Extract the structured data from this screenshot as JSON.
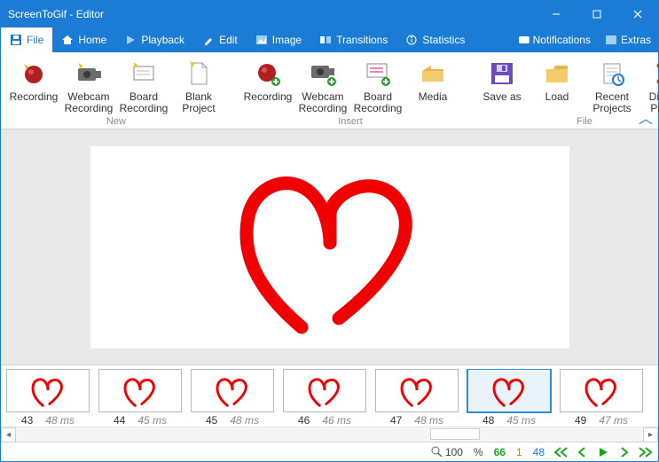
{
  "window": {
    "title": "ScreenToGif - Editor"
  },
  "menu": {
    "file": "File",
    "home": "Home",
    "playback": "Playback",
    "edit": "Edit",
    "image": "Image",
    "transitions": "Transitions",
    "statistics": "Statistics",
    "notifications": "Notifications",
    "extras": "Extras"
  },
  "ribbon": {
    "new": {
      "label": "New",
      "recording": "Recording",
      "webcam": "Webcam Recording",
      "board": "Board Recording",
      "blank": "Blank Project"
    },
    "insert": {
      "label": "Insert",
      "recording": "Recording",
      "webcam": "Webcam Recording",
      "board": "Board Recording",
      "media": "Media"
    },
    "file": {
      "label": "File",
      "saveas": "Save as",
      "load": "Load",
      "recent": "Recent Projects",
      "discard": "Discard Project"
    }
  },
  "thumbs": [
    {
      "n": "43",
      "ms": "48 ms"
    },
    {
      "n": "44",
      "ms": "45 ms"
    },
    {
      "n": "45",
      "ms": "48 ms"
    },
    {
      "n": "46",
      "ms": "46 ms"
    },
    {
      "n": "47",
      "ms": "48 ms"
    },
    {
      "n": "48",
      "ms": "45 ms",
      "sel": true
    },
    {
      "n": "49",
      "ms": "47 ms"
    }
  ],
  "status": {
    "zoom": "100",
    "pct": "%",
    "frames_remaining": "66",
    "sel_count": "1",
    "current": "48"
  }
}
